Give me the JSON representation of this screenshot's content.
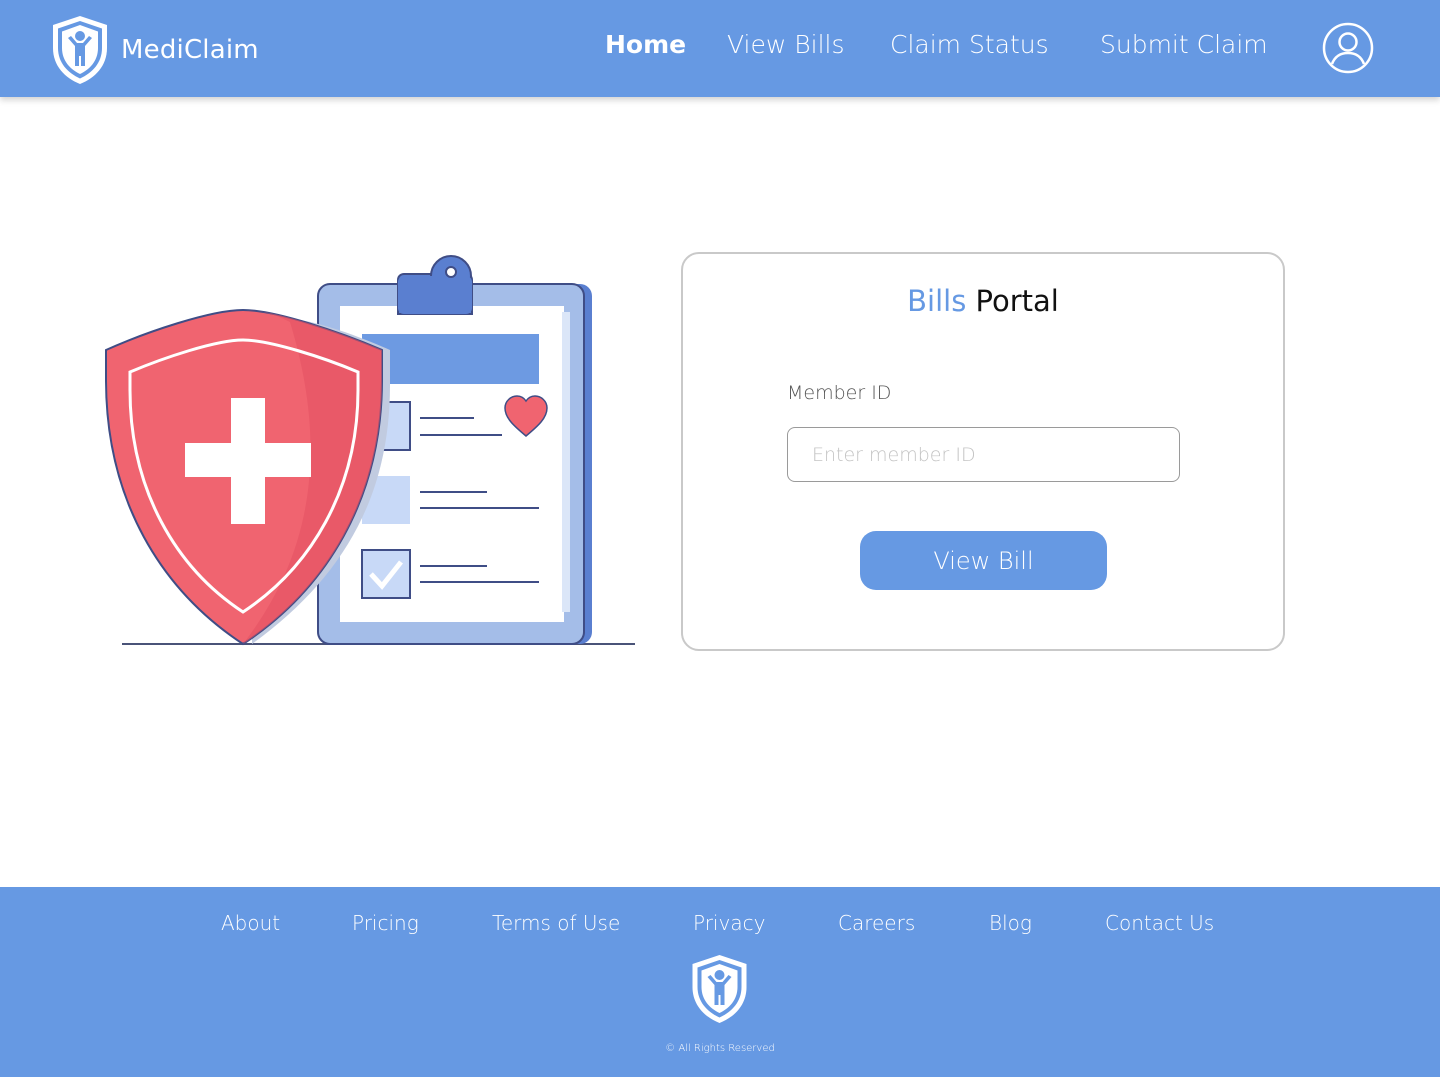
{
  "header": {
    "brand_name": "MediClaim",
    "nav": {
      "home": "Home",
      "view_bills": "View Bills",
      "claim_status": "Claim Status",
      "submit_claim": "Submit Claim"
    },
    "active_nav": "Home"
  },
  "portal": {
    "title_accent": "Bills",
    "title_rest": "Portal",
    "member_id_label": "Member ID",
    "member_id_placeholder": "Enter member ID",
    "member_id_value": "",
    "view_bill_button": "View Bill"
  },
  "footer": {
    "links": {
      "about": "About",
      "pricing": "Pricing",
      "terms": "Terms of Use",
      "privacy": "Privacy",
      "careers": "Careers",
      "blog": "Blog",
      "contact": "Contact Us"
    },
    "copyright": "© All Rights Reserved"
  },
  "icons": {
    "brand_logo": "shield-person-icon",
    "profile": "user-circle-icon",
    "footer_logo": "shield-person-icon",
    "illustration": "medical-shield-clipboard-illustration"
  },
  "colors": {
    "primary": "#6699e3",
    "shield_red": "#f06470",
    "clipboard_blue": "#a4bde8",
    "clip_dark": "#5a7fd0"
  }
}
